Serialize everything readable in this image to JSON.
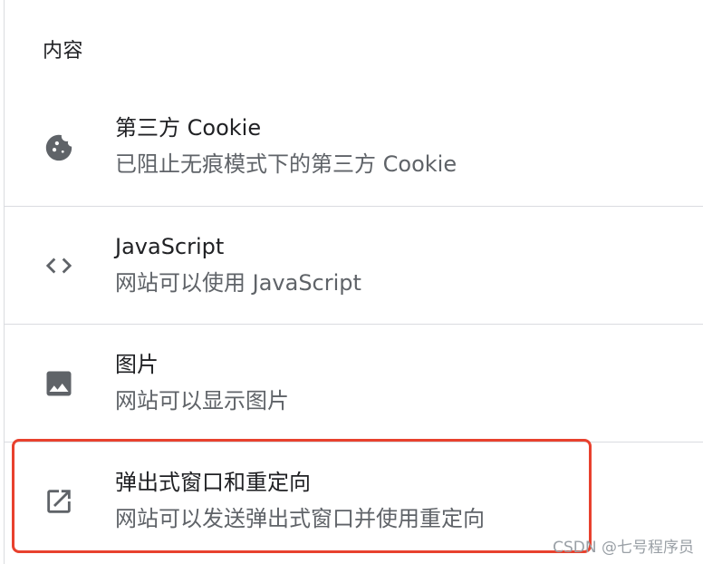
{
  "section": {
    "title": "内容"
  },
  "items": [
    {
      "icon": "cookie-icon",
      "label": "第三方 Cookie",
      "sublabel": "已阻止无痕模式下的第三方 Cookie"
    },
    {
      "icon": "code-icon",
      "label": "JavaScript",
      "sublabel": "网站可以使用 JavaScript"
    },
    {
      "icon": "image-icon",
      "label": "图片",
      "sublabel": "网站可以显示图片"
    },
    {
      "icon": "open-in-new-icon",
      "label": "弹出式窗口和重定向",
      "sublabel": "网站可以发送弹出式窗口并使用重定向"
    }
  ],
  "highlight_color": "#e8412e",
  "watermark": "CSDN @七号程序员"
}
